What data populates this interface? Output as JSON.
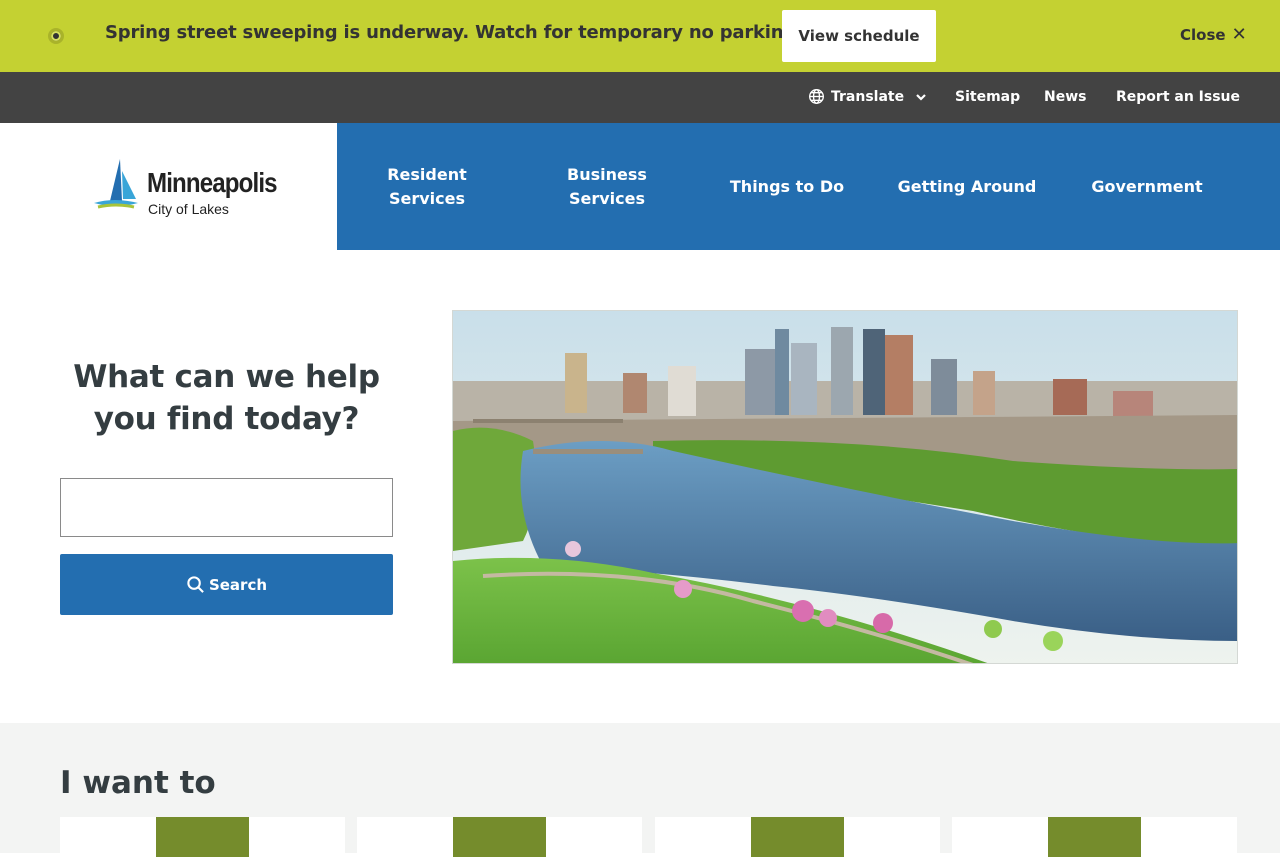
{
  "alert": {
    "message": "Spring street sweeping is underway. Watch for temporary no parking signs.",
    "button_label": "View schedule",
    "close_label": "Close",
    "color": "#c4d132"
  },
  "utility_nav": {
    "translate_label": "Translate",
    "sitemap_label": "Sitemap",
    "news_label": "News",
    "report_label": "Report an Issue"
  },
  "header": {
    "logo_title": "Minneapolis",
    "logo_subtitle": "City of Lakes",
    "nav": [
      {
        "line1": "Resident",
        "line2": "Services"
      },
      {
        "line1": "Business",
        "line2": "Services"
      },
      {
        "line1": "Things to Do",
        "line2": ""
      },
      {
        "line1": "Getting Around",
        "line2": ""
      },
      {
        "line1": "Government",
        "line2": ""
      }
    ],
    "nav_color": "#236eb0"
  },
  "hero": {
    "heading_line1": "What can we help",
    "heading_line2": "you find today?",
    "search_placeholder": "",
    "search_value": "",
    "search_button_label": "Search"
  },
  "i_want_to": {
    "title": "I want to",
    "icon_color": "#758c2c"
  }
}
